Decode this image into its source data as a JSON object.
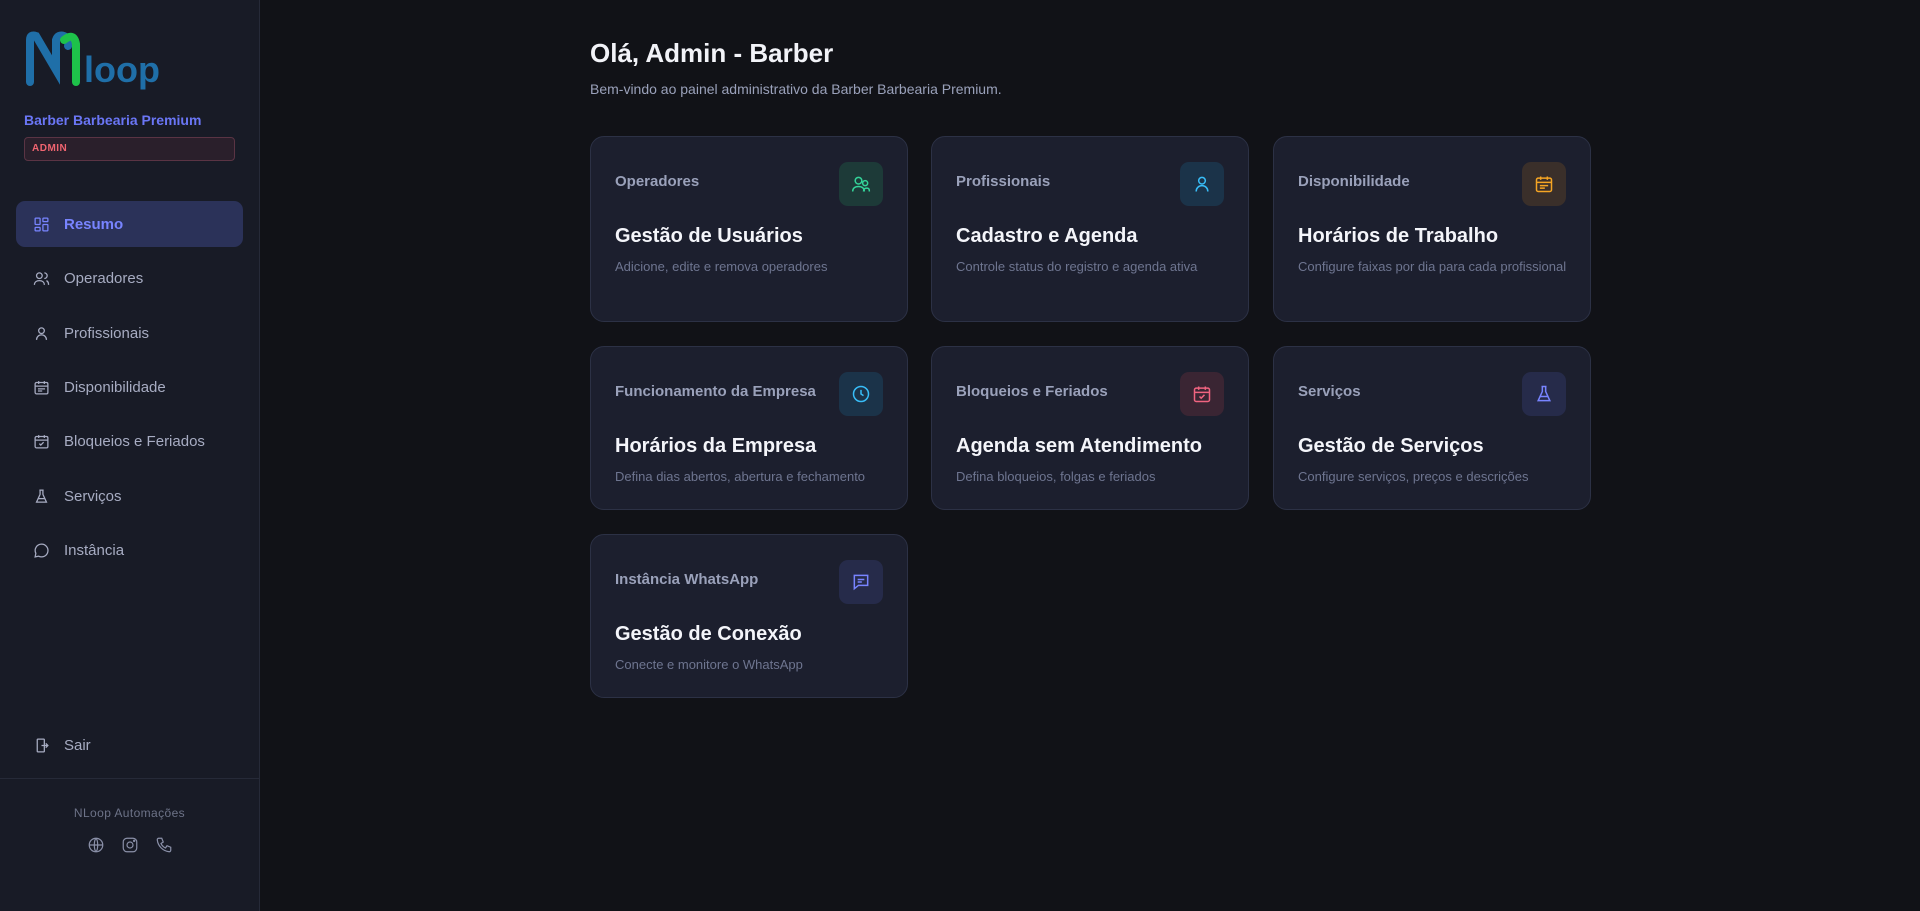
{
  "brand": {
    "logo_text": "NLoop",
    "company": "Barber Barbearia Premium",
    "role_badge": "ADMIN"
  },
  "nav": {
    "items": [
      {
        "label": "Resumo",
        "icon": "dashboard-icon",
        "active": true
      },
      {
        "label": "Operadores",
        "icon": "users-icon",
        "active": false
      },
      {
        "label": "Profissionais",
        "icon": "user-icon",
        "active": false
      },
      {
        "label": "Disponibilidade",
        "icon": "calendar-list-icon",
        "active": false
      },
      {
        "label": "Bloqueios e Feriados",
        "icon": "calendar-check-icon",
        "active": false
      },
      {
        "label": "Serviços",
        "icon": "flask-icon",
        "active": false
      },
      {
        "label": "Instância",
        "icon": "chat-bubble-icon",
        "active": false
      }
    ],
    "logout_label": "Sair"
  },
  "footer": {
    "title": "NLoop Automações",
    "icons": [
      "globe-icon",
      "instagram-icon",
      "phone-icon"
    ]
  },
  "header": {
    "greeting": "Olá, Admin - Barber",
    "subtitle": "Bem-vindo ao painel administrativo da Barber Barbearia Premium."
  },
  "cards": [
    {
      "label": "Operadores",
      "title": "Gestão de Usuários",
      "description": "Adicione, edite e remova operadores",
      "icon": "users-icon",
      "color": "#34d399"
    },
    {
      "label": "Profissionais",
      "title": "Cadastro e Agenda",
      "description": "Controle status do registro e agenda ativa",
      "icon": "user-icon",
      "color": "#38bdf8"
    },
    {
      "label": "Disponibilidade",
      "title": "Horários de Trabalho",
      "description": "Configure faixas por dia para cada profissional",
      "icon": "calendar-list-icon",
      "color": "#f5a524"
    },
    {
      "label": "Funcionamento da Empresa",
      "title": "Horários da Empresa",
      "description": "Defina dias abertos, abertura e fechamento",
      "icon": "clock-icon",
      "color": "#38bdf8"
    },
    {
      "label": "Bloqueios e Feriados",
      "title": "Agenda sem Atendimento",
      "description": "Defina bloqueios, folgas e feriados",
      "icon": "calendar-check-icon",
      "color": "#f06480"
    },
    {
      "label": "Serviços",
      "title": "Gestão de Serviços",
      "description": "Configure serviços, preços e descrições",
      "icon": "flask-icon",
      "color": "#7884ff"
    },
    {
      "label": "Instância WhatsApp",
      "title": "Gestão de Conexão",
      "description": "Conecte e monitore o WhatsApp",
      "icon": "chat-bubble-icon",
      "color": "#7884ff"
    }
  ]
}
